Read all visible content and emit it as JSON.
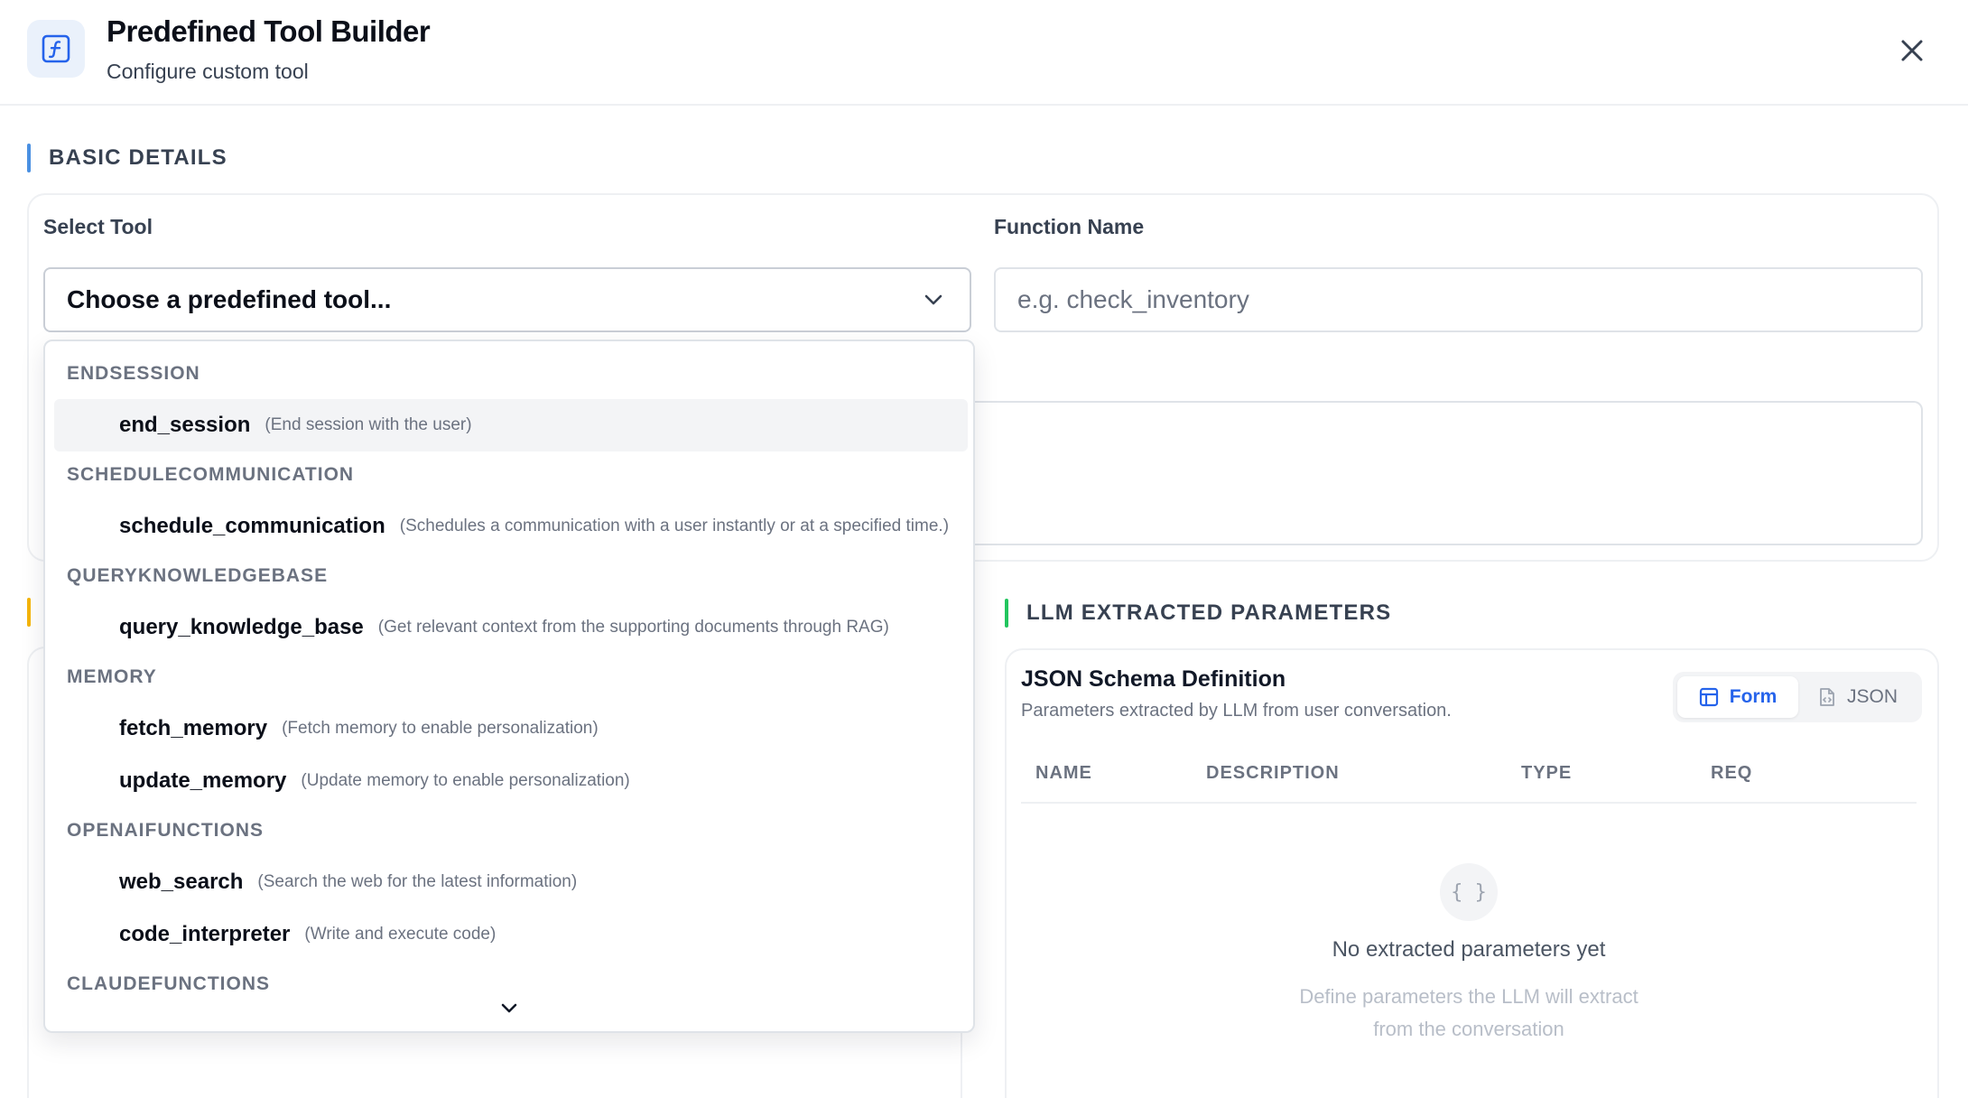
{
  "header": {
    "title": "Predefined Tool Builder",
    "subtitle": "Configure custom tool",
    "icon": "function-icon"
  },
  "colors": {
    "accent": "#2563eb",
    "basic_bar": "#4a90e2",
    "tool_bar": "#f5b50a",
    "llm_bar": "#22c55e"
  },
  "basic_details": {
    "section_title": "BASIC DETAILS",
    "select_tool_label": "Select Tool",
    "select_tool_value": "Choose a predefined tool...",
    "function_name_label": "Function Name",
    "function_name_placeholder": "e.g. check_inventory"
  },
  "dropdown": {
    "groups": [
      {
        "name": "ENDSESSION",
        "options": [
          {
            "name": "end_session",
            "desc": "(End session with the user)"
          }
        ]
      },
      {
        "name": "SCHEDULECOMMUNICATION",
        "options": [
          {
            "name": "schedule_communication",
            "desc": "(Schedules a communication with a user instantly or at a specified time.)"
          }
        ]
      },
      {
        "name": "QUERYKNOWLEDGEBASE",
        "options": [
          {
            "name": "query_knowledge_base",
            "desc": "(Get relevant context from the supporting documents through RAG)"
          }
        ]
      },
      {
        "name": "MEMORY",
        "options": [
          {
            "name": "fetch_memory",
            "desc": "(Fetch memory to enable personalization)"
          },
          {
            "name": "update_memory",
            "desc": "(Update memory to enable personalization)"
          }
        ]
      },
      {
        "name": "OPENAIFUNCTIONS",
        "options": [
          {
            "name": "web_search",
            "desc": "(Search the web for the latest information)"
          },
          {
            "name": "code_interpreter",
            "desc": "(Write and execute code)"
          }
        ]
      },
      {
        "name": "CLAUDEFUNCTIONS",
        "options": []
      }
    ]
  },
  "llm_params": {
    "section_title": "LLM EXTRACTED PARAMETERS",
    "schema_title": "JSON Schema Definition",
    "schema_desc": "Parameters extracted by LLM from user conversation.",
    "toggle": {
      "form": "Form",
      "json": "JSON"
    },
    "columns": [
      "NAME",
      "DESCRIPTION",
      "TYPE",
      "REQ"
    ],
    "empty_icon_glyph": "{ }",
    "empty_title": "No extracted parameters yet",
    "empty_sub_line1": "Define parameters the LLM will extract",
    "empty_sub_line2": "from the conversation"
  }
}
